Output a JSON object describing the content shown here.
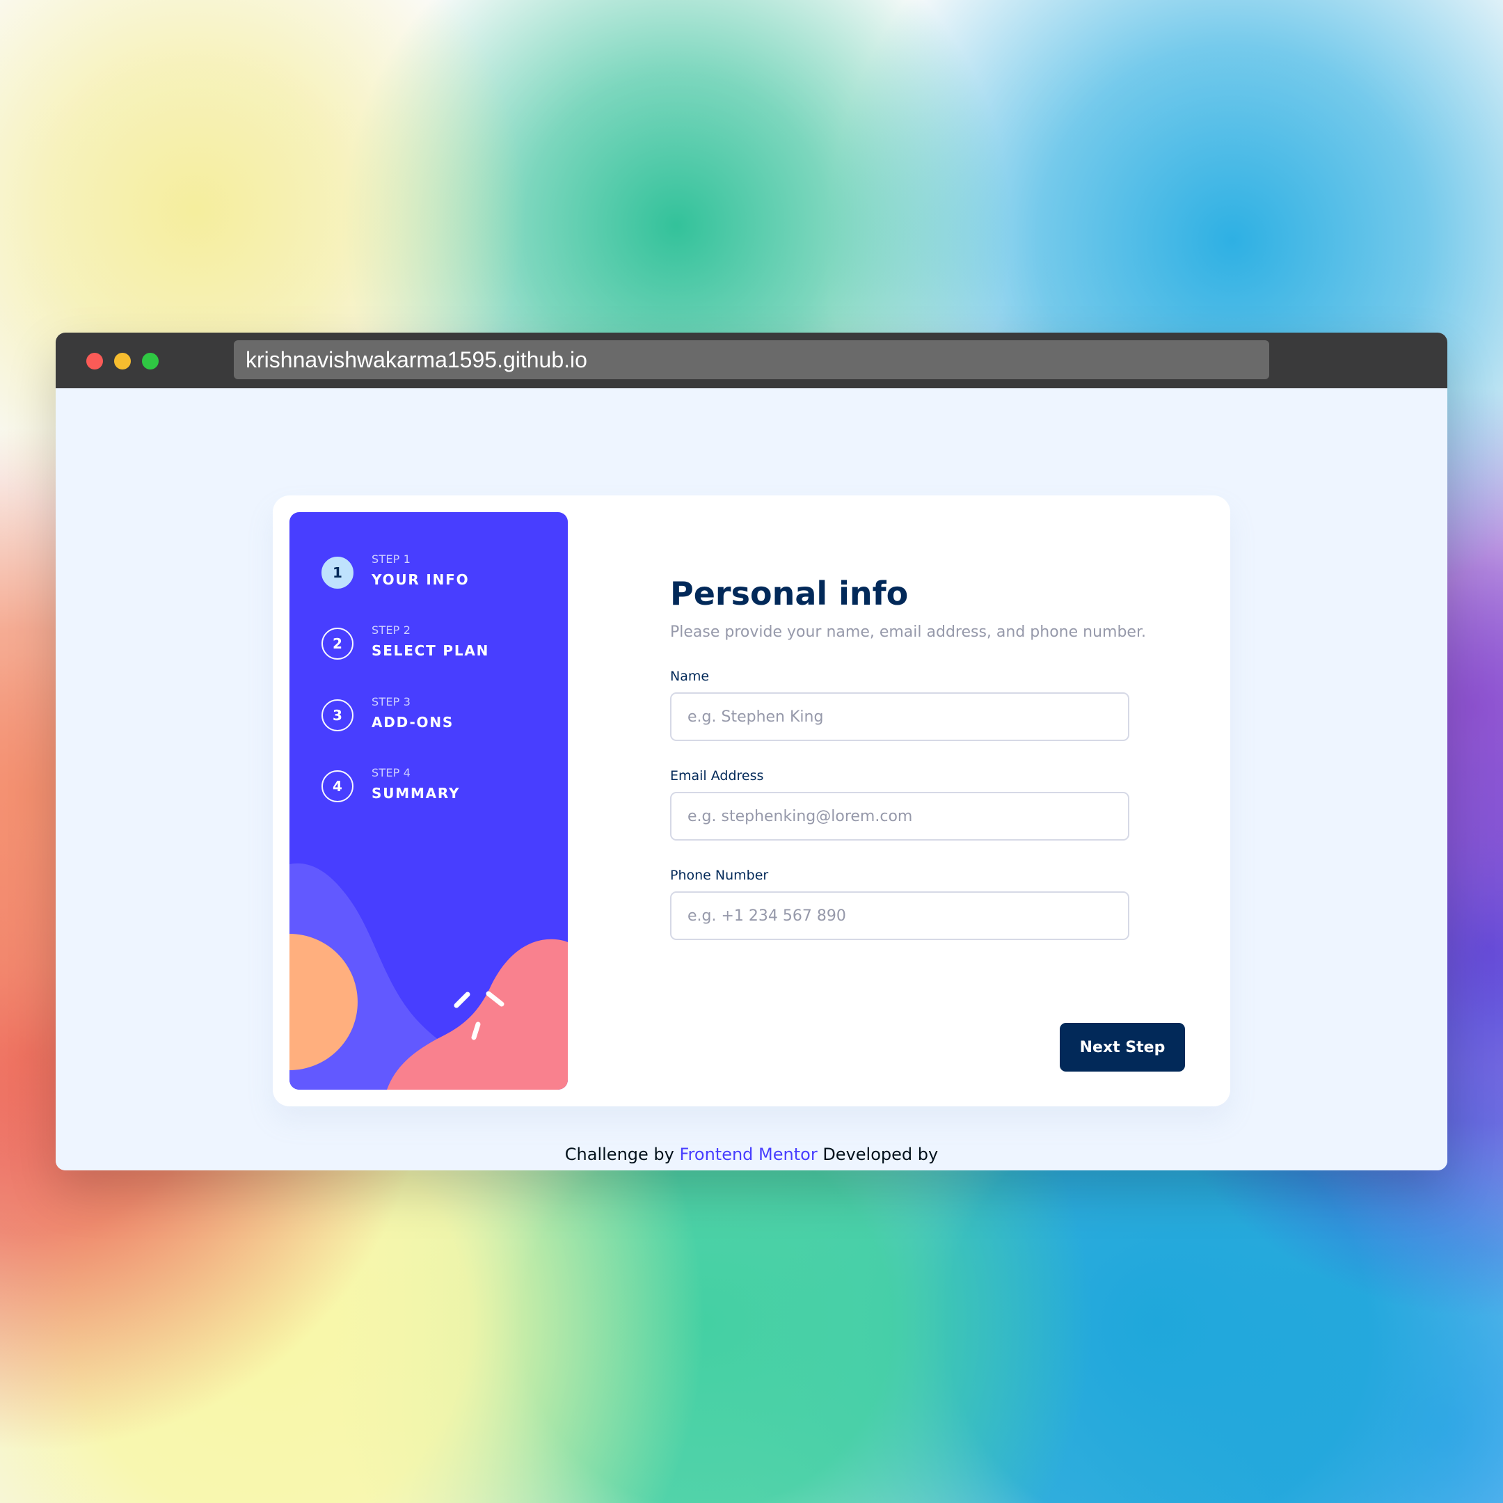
{
  "browser": {
    "address": "krishnavishwakarma1595.github.io"
  },
  "sidebar": {
    "steps": [
      {
        "number": "1",
        "small": "STEP 1",
        "title": "YOUR INFO"
      },
      {
        "number": "2",
        "small": "STEP 2",
        "title": "SELECT PLAN"
      },
      {
        "number": "3",
        "small": "STEP 3",
        "title": "ADD-ONS"
      },
      {
        "number": "4",
        "small": "STEP 4",
        "title": "SUMMARY"
      }
    ]
  },
  "form": {
    "title": "Personal info",
    "subtitle": "Please provide your name, email address, and phone number.",
    "fields": [
      {
        "label": "Name",
        "value": "",
        "placeholder": "e.g. Stephen King"
      },
      {
        "label": "Email Address",
        "value": "",
        "placeholder": "e.g. stephenking@lorem.com"
      },
      {
        "label": "Phone Number",
        "value": "",
        "placeholder": "e.g. +1 234 567 890"
      }
    ],
    "next_button": "Next Step"
  },
  "footer": {
    "prefix": "Challenge by",
    "link_text": "Frontend Mentor",
    "suffix": "Developed by"
  },
  "colors": {
    "sidebar_background": "#483eff",
    "active_step_background": "#bfe2fd",
    "primary_text": "#022959",
    "secondary_text": "#9699aa",
    "button_background": "#022959",
    "page_background": "#eef5ff"
  },
  "icons": {
    "window_close": "red-traffic-light-icon",
    "window_minimize": "yellow-traffic-light-icon",
    "window_zoom": "green-traffic-light-icon",
    "sidebar_art": "abstract-shapes-icon"
  }
}
